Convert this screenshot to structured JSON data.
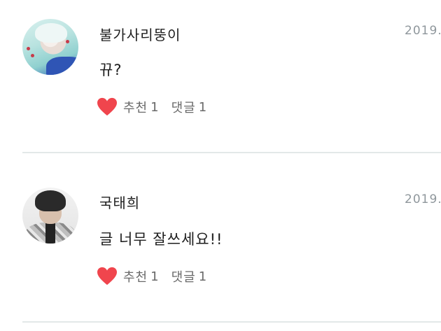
{
  "comments": [
    {
      "username": "불가사리뚱이",
      "date": "2019.",
      "text": "뀨?",
      "like_label": "추천",
      "like_count": "1",
      "reply_label": "댓글",
      "reply_count": "1",
      "heart_color": "#f0454d"
    },
    {
      "username": "국태희",
      "date": "2019.",
      "text": "글 너무 잘쓰세요!!",
      "like_label": "추천",
      "like_count": "1",
      "reply_label": "댓글",
      "reply_count": "1",
      "heart_color": "#f0454d"
    }
  ],
  "colors": {
    "divider": "#e3e8e8",
    "meta_text": "#8f979c",
    "action_text": "#6a6a6a"
  }
}
